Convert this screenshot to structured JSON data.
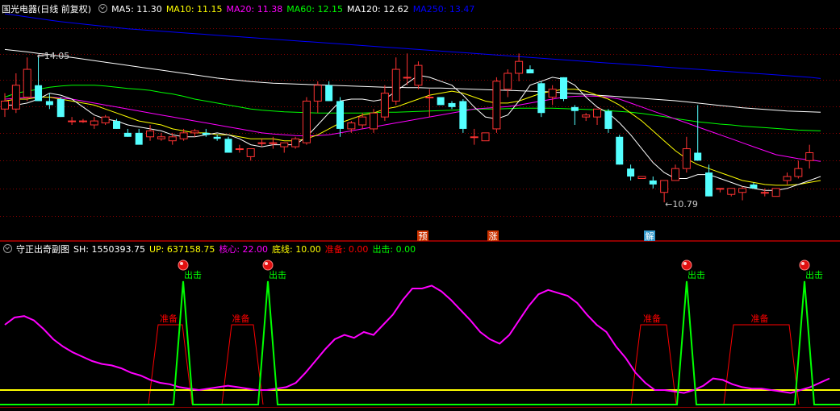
{
  "main_legend": {
    "stock_title": "国光电器(日线 前复权)",
    "items": [
      {
        "label": "MA5: 11.30",
        "color": "#ffffff"
      },
      {
        "label": "MA10: 11.15",
        "color": "#ffff00"
      },
      {
        "label": "MA20: 11.38",
        "color": "#ff00ff"
      },
      {
        "label": "MA60: 12.15",
        "color": "#00ff00"
      },
      {
        "label": "MA120: 12.62",
        "color": "#ffffff"
      },
      {
        "label": "MA250: 13.47",
        "color": "#0000ff"
      }
    ]
  },
  "sub_legend": {
    "title": "守正出奇副图",
    "items": [
      {
        "label": "SH: 1550393.75",
        "color": "#ffffff"
      },
      {
        "label": "UP: 637158.75",
        "color": "#ffff00"
      },
      {
        "label": "核心: 22.00",
        "color": "#ff00ff"
      },
      {
        "label": "底线: 10.00",
        "color": "#ffff00"
      },
      {
        "label": "准备: 0.00",
        "color": "#ff0000"
      },
      {
        "label": "出击: 0.00",
        "color": "#00ff00"
      }
    ]
  },
  "colors": {
    "up": "#ff3333",
    "down": "#54ffff",
    "core": "#ff00ff",
    "baseline": "#ffff00",
    "prepare": "#ff0000",
    "strike": "#00ff00",
    "grid": "#8b0000",
    "marker_bg": "#cc3300"
  },
  "chart_data": [
    {
      "type": "candlestick",
      "price_ylim": [
        9.6,
        15.0
      ],
      "high_annotation": "14.05",
      "low_annotation": "10.79",
      "signal_markers": [
        "预",
        "涨",
        "解"
      ],
      "candles": [
        {
          "o": 12.7,
          "h": 13.1,
          "l": 12.5,
          "c": 12.9
        },
        {
          "o": 12.7,
          "h": 13.6,
          "l": 12.6,
          "c": 13.3
        },
        {
          "o": 13.0,
          "h": 14.0,
          "l": 12.9,
          "c": 13.7
        },
        {
          "o": 13.3,
          "h": 14.05,
          "l": 13.0,
          "c": 12.9
        },
        {
          "o": 12.9,
          "h": 13.1,
          "l": 12.7,
          "c": 12.8
        },
        {
          "o": 12.95,
          "h": 13.0,
          "l": 12.5,
          "c": 12.5
        },
        {
          "o": 12.4,
          "h": 12.5,
          "l": 12.3,
          "c": 12.4
        },
        {
          "o": 12.4,
          "h": 12.45,
          "l": 12.35,
          "c": 12.4
        },
        {
          "o": 12.3,
          "h": 12.5,
          "l": 12.2,
          "c": 12.4
        },
        {
          "o": 12.35,
          "h": 12.55,
          "l": 12.3,
          "c": 12.5
        },
        {
          "o": 12.4,
          "h": 12.45,
          "l": 12.2,
          "c": 12.2
        },
        {
          "o": 12.1,
          "h": 12.2,
          "l": 12.0,
          "c": 12.0
        },
        {
          "o": 12.1,
          "h": 12.2,
          "l": 11.9,
          "c": 11.8
        },
        {
          "o": 12.0,
          "h": 12.3,
          "l": 11.9,
          "c": 12.15
        },
        {
          "o": 11.95,
          "h": 12.1,
          "l": 11.9,
          "c": 12.0
        },
        {
          "o": 11.9,
          "h": 12.1,
          "l": 11.8,
          "c": 12.0
        },
        {
          "o": 11.95,
          "h": 12.2,
          "l": 11.9,
          "c": 12.1
        },
        {
          "o": 12.1,
          "h": 12.2,
          "l": 12.0,
          "c": 12.15
        },
        {
          "o": 12.1,
          "h": 12.2,
          "l": 12.0,
          "c": 12.05
        },
        {
          "o": 12.0,
          "h": 12.05,
          "l": 11.9,
          "c": 11.95
        },
        {
          "o": 11.95,
          "h": 12.0,
          "l": 11.6,
          "c": 11.6
        },
        {
          "o": 11.7,
          "h": 11.8,
          "l": 11.6,
          "c": 11.7
        },
        {
          "o": 11.5,
          "h": 11.7,
          "l": 11.4,
          "c": 11.7
        },
        {
          "o": 11.85,
          "h": 11.95,
          "l": 11.75,
          "c": 11.85
        },
        {
          "o": 11.85,
          "h": 12.0,
          "l": 11.7,
          "c": 11.85
        },
        {
          "o": 11.75,
          "h": 11.85,
          "l": 11.6,
          "c": 11.85
        },
        {
          "o": 11.75,
          "h": 12.0,
          "l": 11.7,
          "c": 11.95
        },
        {
          "o": 11.85,
          "h": 13.0,
          "l": 11.8,
          "c": 12.9
        },
        {
          "o": 12.9,
          "h": 13.4,
          "l": 12.6,
          "c": 13.3
        },
        {
          "o": 13.3,
          "h": 13.4,
          "l": 12.9,
          "c": 12.9
        },
        {
          "o": 12.9,
          "h": 13.0,
          "l": 12.0,
          "c": 12.2
        },
        {
          "o": 12.2,
          "h": 12.4,
          "l": 12.1,
          "c": 12.35
        },
        {
          "o": 12.3,
          "h": 12.6,
          "l": 12.2,
          "c": 12.5
        },
        {
          "o": 12.2,
          "h": 12.7,
          "l": 12.1,
          "c": 12.6
        },
        {
          "o": 12.5,
          "h": 13.3,
          "l": 12.4,
          "c": 13.1
        },
        {
          "o": 12.9,
          "h": 14.0,
          "l": 12.8,
          "c": 13.7
        },
        {
          "o": 13.5,
          "h": 14.1,
          "l": 13.3,
          "c": 13.5
        },
        {
          "o": 13.3,
          "h": 13.9,
          "l": 13.2,
          "c": 13.8
        },
        {
          "o": 13.0,
          "h": 13.2,
          "l": 12.5,
          "c": 13.0
        },
        {
          "o": 13.0,
          "h": 13.0,
          "l": 12.8,
          "c": 12.8
        },
        {
          "o": 12.85,
          "h": 12.9,
          "l": 12.7,
          "c": 12.75
        },
        {
          "o": 12.9,
          "h": 12.95,
          "l": 12.1,
          "c": 12.2
        },
        {
          "o": 12.0,
          "h": 12.2,
          "l": 11.8,
          "c": 12.0
        },
        {
          "o": 11.9,
          "h": 12.1,
          "l": 11.9,
          "c": 12.1
        },
        {
          "o": 12.2,
          "h": 13.5,
          "l": 12.1,
          "c": 13.4
        },
        {
          "o": 13.2,
          "h": 13.7,
          "l": 13.0,
          "c": 13.6
        },
        {
          "o": 13.6,
          "h": 14.1,
          "l": 13.4,
          "c": 13.9
        },
        {
          "o": 13.7,
          "h": 13.8,
          "l": 13.6,
          "c": 13.6
        },
        {
          "o": 13.35,
          "h": 13.4,
          "l": 12.5,
          "c": 12.6
        },
        {
          "o": 13.0,
          "h": 13.3,
          "l": 12.8,
          "c": 13.2
        },
        {
          "o": 13.5,
          "h": 13.5,
          "l": 12.9,
          "c": 12.95
        },
        {
          "o": 12.75,
          "h": 12.8,
          "l": 12.3,
          "c": 12.65
        },
        {
          "o": 12.5,
          "h": 12.6,
          "l": 12.4,
          "c": 12.55
        },
        {
          "o": 12.5,
          "h": 12.7,
          "l": 12.3,
          "c": 12.7
        },
        {
          "o": 12.65,
          "h": 12.7,
          "l": 12.1,
          "c": 12.2
        },
        {
          "o": 12.0,
          "h": 12.05,
          "l": 11.3,
          "c": 11.3
        },
        {
          "o": 11.2,
          "h": 11.3,
          "l": 10.9,
          "c": 11.0
        },
        {
          "o": 10.95,
          "h": 11.0,
          "l": 10.95,
          "c": 11.0
        },
        {
          "o": 10.9,
          "h": 11.0,
          "l": 10.7,
          "c": 10.8
        },
        {
          "o": 10.6,
          "h": 10.9,
          "l": 10.35,
          "c": 10.9
        },
        {
          "o": 10.9,
          "h": 11.3,
          "l": 10.9,
          "c": 11.2
        },
        {
          "o": 11.2,
          "h": 12.0,
          "l": 11.1,
          "c": 11.7
        },
        {
          "o": 11.6,
          "h": 12.8,
          "l": 11.4,
          "c": 11.4
        },
        {
          "o": 11.1,
          "h": 11.3,
          "l": 10.5,
          "c": 10.5
        },
        {
          "o": 10.7,
          "h": 10.7,
          "l": 10.6,
          "c": 10.7
        },
        {
          "o": 10.55,
          "h": 10.7,
          "l": 10.5,
          "c": 10.7
        },
        {
          "o": 10.6,
          "h": 10.75,
          "l": 10.4,
          "c": 10.7
        },
        {
          "o": 10.8,
          "h": 10.85,
          "l": 10.7,
          "c": 10.7
        },
        {
          "o": 10.6,
          "h": 10.7,
          "l": 10.5,
          "c": 10.6
        },
        {
          "o": 10.5,
          "h": 10.7,
          "l": 10.5,
          "c": 10.7
        },
        {
          "o": 10.9,
          "h": 11.1,
          "l": 10.8,
          "c": 11.0
        },
        {
          "o": 11.0,
          "h": 11.4,
          "l": 10.95,
          "c": 11.2
        },
        {
          "o": 11.4,
          "h": 11.8,
          "l": 11.2,
          "c": 11.6
        }
      ],
      "ma_series": [
        {
          "name": "MA5",
          "color": "#ffffff",
          "values": [
            12.8,
            12.8,
            12.85,
            12.95,
            13.1,
            13.05,
            12.95,
            12.75,
            12.55,
            12.45,
            12.4,
            12.3,
            12.25,
            12.2,
            12.15,
            12.05,
            12.0,
            12.0,
            12.05,
            12.1,
            12.05,
            11.95,
            11.8,
            11.75,
            11.8,
            11.8,
            11.8,
            12.0,
            12.3,
            12.6,
            12.9,
            12.95,
            12.95,
            12.9,
            12.95,
            13.15,
            13.35,
            13.55,
            13.5,
            13.4,
            13.3,
            13.05,
            12.75,
            12.5,
            12.45,
            12.55,
            12.9,
            13.3,
            13.4,
            13.5,
            13.45,
            13.3,
            13.0,
            12.75,
            12.6,
            12.35,
            12.05,
            11.7,
            11.35,
            11.1,
            10.95,
            10.95,
            11.05,
            11.05,
            10.95,
            10.85,
            10.75,
            10.7,
            10.65,
            10.65,
            10.7,
            10.8,
            10.9,
            11.0
          ]
        },
        {
          "name": "MA10",
          "color": "#ffff00",
          "values": [
            12.9,
            12.95,
            12.95,
            13.0,
            13.0,
            12.95,
            12.9,
            12.85,
            12.8,
            12.7,
            12.6,
            12.5,
            12.4,
            12.35,
            12.3,
            12.2,
            12.15,
            12.1,
            12.1,
            12.05,
            12.05,
            12.0,
            11.95,
            11.95,
            11.95,
            11.9,
            11.9,
            11.95,
            12.05,
            12.2,
            12.35,
            12.45,
            12.55,
            12.6,
            12.7,
            12.75,
            12.85,
            12.95,
            13.05,
            13.1,
            13.15,
            13.1,
            13.0,
            12.9,
            12.85,
            12.85,
            12.9,
            13.0,
            13.1,
            13.15,
            13.2,
            13.2,
            13.15,
            13.05,
            12.95,
            12.8,
            12.6,
            12.4,
            12.15,
            11.9,
            11.65,
            11.45,
            11.3,
            11.2,
            11.1,
            11.0,
            10.9,
            10.85,
            10.8,
            10.78,
            10.78,
            10.8,
            10.85,
            10.9
          ]
        },
        {
          "name": "MA20",
          "color": "#ff00ff",
          "values": [
            12.95,
            12.97,
            12.99,
            13.0,
            13.0,
            12.98,
            12.95,
            12.9,
            12.85,
            12.8,
            12.75,
            12.7,
            12.65,
            12.6,
            12.55,
            12.5,
            12.45,
            12.4,
            12.35,
            12.3,
            12.25,
            12.2,
            12.15,
            12.1,
            12.07,
            12.05,
            12.03,
            12.02,
            12.03,
            12.05,
            12.1,
            12.15,
            12.2,
            12.25,
            12.3,
            12.35,
            12.4,
            12.45,
            12.5,
            12.55,
            12.6,
            12.65,
            12.7,
            12.72,
            12.74,
            12.76,
            12.8,
            12.85,
            12.9,
            12.95,
            13.0,
            13.02,
            13.03,
            13.02,
            13.0,
            12.95,
            12.85,
            12.75,
            12.65,
            12.55,
            12.45,
            12.35,
            12.25,
            12.15,
            12.05,
            11.95,
            11.85,
            11.75,
            11.65,
            11.55,
            11.5,
            11.45,
            11.42,
            11.38
          ]
        },
        {
          "name": "MA60",
          "color": "#00ff00",
          "values": [
            13.0,
            13.1,
            13.15,
            13.2,
            13.25,
            13.28,
            13.3,
            13.3,
            13.3,
            13.28,
            13.25,
            13.22,
            13.2,
            13.17,
            13.12,
            13.08,
            13.02,
            12.95,
            12.9,
            12.85,
            12.8,
            12.75,
            12.7,
            12.67,
            12.65,
            12.63,
            12.62,
            12.61,
            12.6,
            12.6,
            12.6,
            12.6,
            12.6,
            12.61,
            12.62,
            12.62,
            12.63,
            12.64,
            12.65,
            12.66,
            12.67,
            12.68,
            12.69,
            12.7,
            12.7,
            12.71,
            12.72,
            12.72,
            12.72,
            12.72,
            12.71,
            12.7,
            12.69,
            12.68,
            12.66,
            12.64,
            12.62,
            12.59,
            12.55,
            12.51,
            12.46,
            12.42,
            12.38,
            12.35,
            12.32,
            12.3,
            12.27,
            12.25,
            12.23,
            12.21,
            12.19,
            12.17,
            12.16,
            12.15
          ]
        },
        {
          "name": "MA120",
          "color": "#ffffff",
          "values": [
            14.2,
            14.17,
            14.14,
            14.1,
            14.07,
            14.03,
            14.0,
            13.96,
            13.92,
            13.88,
            13.84,
            13.8,
            13.76,
            13.72,
            13.68,
            13.64,
            13.6,
            13.56,
            13.52,
            13.48,
            13.45,
            13.42,
            13.39,
            13.37,
            13.35,
            13.34,
            13.33,
            13.32,
            13.31,
            13.3,
            13.29,
            13.28,
            13.27,
            13.26,
            13.25,
            13.25,
            13.24,
            13.24,
            13.23,
            13.23,
            13.22,
            13.21,
            13.2,
            13.19,
            13.18,
            13.17,
            13.16,
            13.15,
            13.14,
            13.13,
            13.11,
            13.09,
            13.07,
            13.05,
            13.03,
            13.01,
            12.99,
            12.97,
            12.95,
            12.93,
            12.91,
            12.88,
            12.85,
            12.82,
            12.79,
            12.76,
            12.73,
            12.71,
            12.69,
            12.67,
            12.65,
            12.64,
            12.63,
            12.62
          ]
        },
        {
          "name": "MA250",
          "color": "#0000ff",
          "values": [
            15.1,
            15.06,
            15.02,
            14.98,
            14.94,
            14.9,
            14.87,
            14.84,
            14.81,
            14.78,
            14.75,
            14.72,
            14.7,
            14.68,
            14.66,
            14.64,
            14.62,
            14.6,
            14.58,
            14.56,
            14.54,
            14.52,
            14.5,
            14.48,
            14.46,
            14.44,
            14.42,
            14.4,
            14.38,
            14.36,
            14.34,
            14.32,
            14.3,
            14.28,
            14.26,
            14.24,
            14.22,
            14.2,
            14.18,
            14.16,
            14.14,
            14.12,
            14.1,
            14.08,
            14.06,
            14.04,
            14.02,
            14.0,
            13.98,
            13.96,
            13.94,
            13.92,
            13.9,
            13.88,
            13.86,
            13.84,
            13.82,
            13.8,
            13.78,
            13.76,
            13.74,
            13.72,
            13.7,
            13.68,
            13.66,
            13.64,
            13.62,
            13.6,
            13.58,
            13.56,
            13.54,
            13.52,
            13.5,
            13.47
          ]
        }
      ]
    },
    {
      "type": "line",
      "title": "守正出奇副图",
      "ylim": [
        0,
        100
      ],
      "baseline": 10,
      "core": [
        55,
        60,
        61,
        58,
        52,
        45,
        40,
        36,
        33,
        30,
        28,
        27,
        25,
        22,
        20,
        17,
        15,
        14,
        12,
        11,
        10,
        11,
        12,
        13,
        12,
        11,
        10,
        10,
        11,
        12,
        15,
        22,
        30,
        38,
        45,
        48,
        46,
        50,
        48,
        55,
        62,
        72,
        80,
        80,
        82,
        78,
        72,
        65,
        58,
        50,
        45,
        42,
        48,
        58,
        68,
        76,
        79,
        77,
        75,
        70,
        62,
        55,
        50,
        40,
        32,
        22,
        15,
        10,
        10,
        9,
        8,
        10,
        13,
        18,
        17,
        14,
        12,
        11,
        11,
        10,
        9,
        8,
        10,
        12,
        15,
        18
      ]
    }
  ],
  "sub_signals": {
    "prepare_label": "准备",
    "strike_label": "出击",
    "prepare_value": 55,
    "strike_value": 85
  }
}
